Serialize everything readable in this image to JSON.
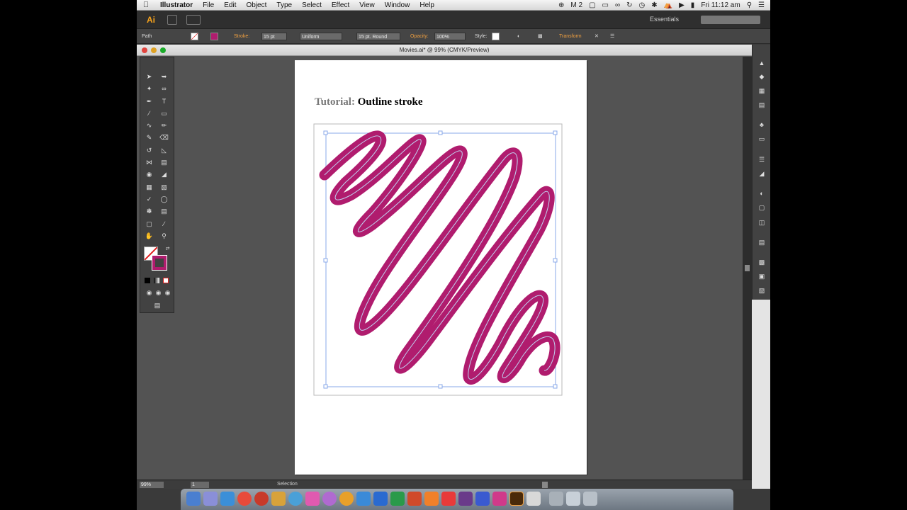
{
  "menubar": {
    "app_name": "Illustrator",
    "items": [
      "File",
      "Edit",
      "Object",
      "Type",
      "Select",
      "Effect",
      "View",
      "Window",
      "Help"
    ],
    "adobe_badge": "2",
    "clock": "Fri 11:12 am"
  },
  "appbar": {
    "logo": "Ai",
    "workspace": "Essentials"
  },
  "controlbar": {
    "selection_type": "Path",
    "stroke_label": "Stroke:",
    "stroke_weight": "15 pt",
    "profile": "Uniform",
    "brush": "15 pt. Round",
    "opacity_label": "Opacity:",
    "opacity_value": "100%",
    "style_label": "Style:",
    "transform_label": "Transform"
  },
  "document": {
    "title": "Movies.ai* @ 99% (CMYK/Preview)",
    "heading_prefix": "Tutorial:",
    "heading_main": "Outline stroke",
    "stroke_color": "#b01c6e"
  },
  "statusbar": {
    "zoom": "99%",
    "page": "1",
    "tool": "Selection"
  },
  "colors": {
    "accent_orange": "#f0a040",
    "stroke_magenta": "#b01c6e"
  }
}
